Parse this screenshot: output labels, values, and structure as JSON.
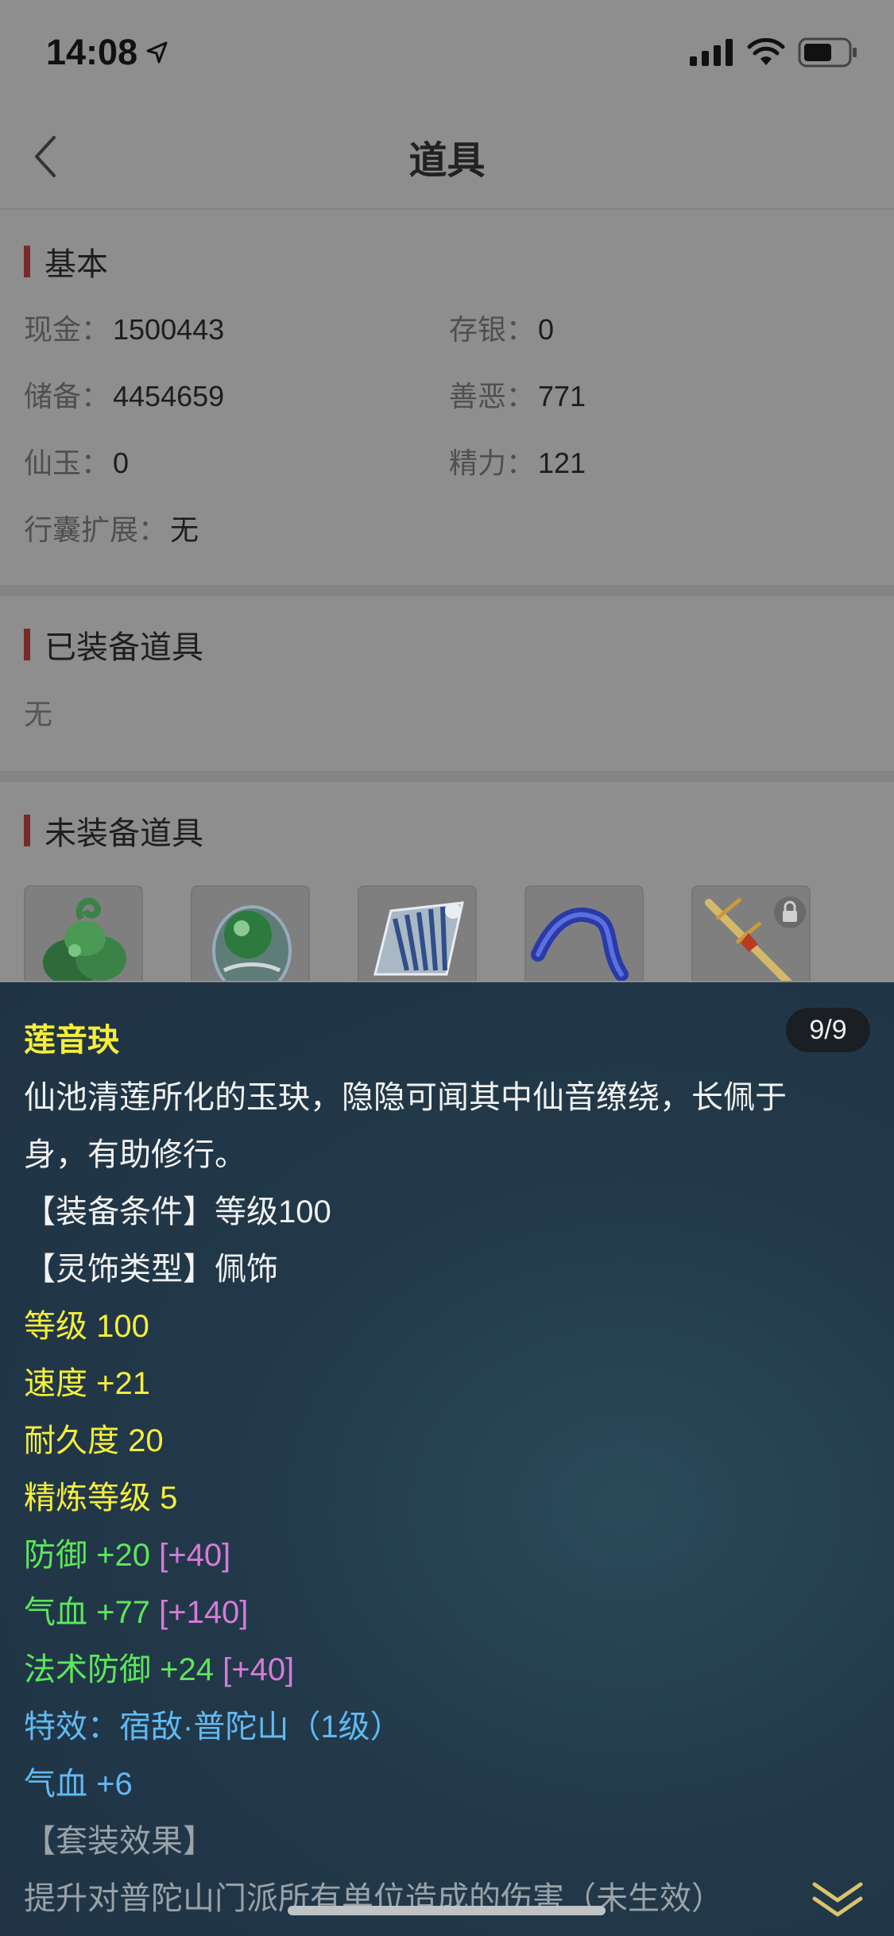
{
  "status": {
    "time": "14:08"
  },
  "nav": {
    "title": "道具"
  },
  "basic": {
    "title": "基本",
    "fields": [
      {
        "label": "现金：",
        "value": "1500443"
      },
      {
        "label": "存银：",
        "value": "0"
      },
      {
        "label": "储备：",
        "value": "4454659"
      },
      {
        "label": "善恶：",
        "value": "771"
      },
      {
        "label": "仙玉：",
        "value": "0"
      },
      {
        "label": "精力：",
        "value": "121"
      },
      {
        "label": "行囊扩展：",
        "value": "无"
      }
    ]
  },
  "equipped": {
    "title": "已装备道具",
    "empty_text": "无"
  },
  "unequipped": {
    "title": "未装备道具",
    "items": [
      {
        "icon": "jade-leaves-item-icon"
      },
      {
        "icon": "jade-pendant-item-icon"
      },
      {
        "icon": "blue-fan-item-icon"
      },
      {
        "icon": "blue-ribbon-item-icon"
      },
      {
        "icon": "golden-sword-item-icon",
        "locked": true
      }
    ]
  },
  "detail": {
    "counter": "9/9",
    "name": "莲音玦",
    "description_line1": "仙池清莲所化的玉玦，隐隐可闻其中仙音缭绕，长佩于",
    "description_line2": "身，有助修行。",
    "equip_condition": "【装备条件】等级100",
    "accessory_type": "【灵饰类型】佩饰",
    "level": "等级 100",
    "speed": "速度 +21",
    "durability": "耐久度 20",
    "refine_level": "精炼等级 5",
    "defense": "防御 +20",
    "defense_bonus": "[+40]",
    "hp": "气血 +77",
    "hp_bonus": "[+140]",
    "magic_defense": "法术防御 +24",
    "magic_defense_bonus": "[+40]",
    "special_effect": "特效：宿敌·普陀山（1级）",
    "extra_hp": "气血 +6",
    "set_effect_title": "【套装效果】",
    "set_effect_text": "提升对普陀山门派所有单位造成的伤害（未生效）"
  },
  "colors": {
    "yellow": "#f5ee3a",
    "green": "#5de65a",
    "purple": "#d77ad8",
    "blue": "#62b9f2",
    "accent": "#7a2a28"
  }
}
